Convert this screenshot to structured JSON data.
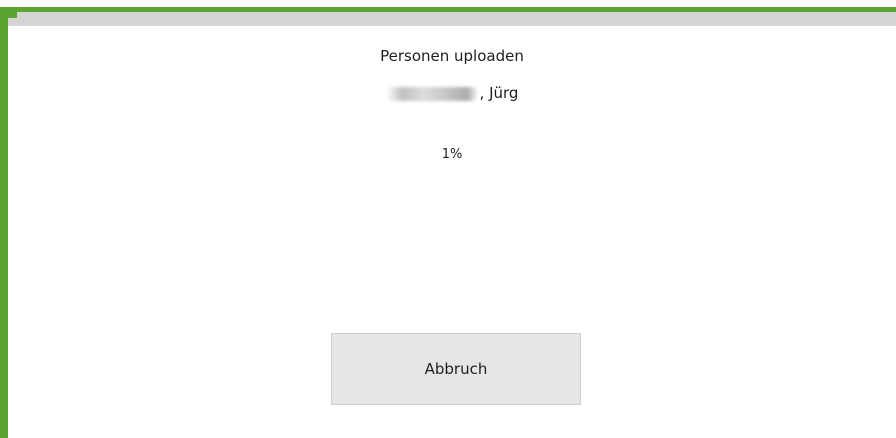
{
  "dialog": {
    "title": "Personen uploaden",
    "person_first_name": "Jürg",
    "person_separator": ",",
    "progress_text": "1%",
    "progress_fraction": 0.01,
    "cancel_label": "Abbruch"
  },
  "colors": {
    "accent": "#5ca32f",
    "track": "#d4d4d4",
    "button_bg": "#e6e6e6",
    "button_border": "#cfcfcf",
    "text": "#1e1e1e"
  }
}
